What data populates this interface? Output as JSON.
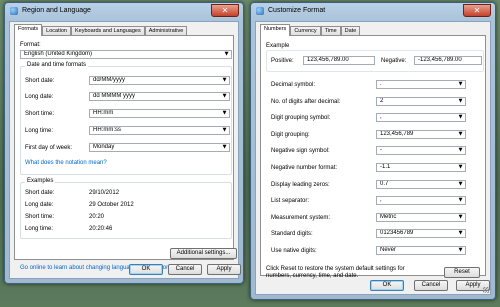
{
  "left_window": {
    "title": "Region and Language",
    "tabs": [
      "Formats",
      "Location",
      "Keyboards and Languages",
      "Administrative"
    ],
    "format_label": "Format:",
    "format_value": "English (United Kingdom)",
    "datetime_group": "Date and time formats",
    "short_date_label": "Short date:",
    "short_date_value": "dd/MM/yyyy",
    "long_date_label": "Long date:",
    "long_date_value": "dd MMMM yyyy",
    "short_time_label": "Short time:",
    "short_time_value": "HH:mm",
    "long_time_label": "Long time:",
    "long_time_value": "HH:mm:ss",
    "first_day_label": "First day of week:",
    "first_day_value": "Monday",
    "notation_link": "What does the notation mean?",
    "examples_group": "Examples",
    "ex_short_date_label": "Short date:",
    "ex_short_date_value": "29/10/2012",
    "ex_long_date_label": "Long date:",
    "ex_long_date_value": "29 October 2012",
    "ex_short_time_label": "Short time:",
    "ex_short_time_value": "20:20",
    "ex_long_time_label": "Long time:",
    "ex_long_time_value": "20:20:46",
    "additional_button": "Additional settings...",
    "online_link": "Go online to learn about changing languages and regional formats",
    "ok": "OK",
    "cancel": "Cancel",
    "apply": "Apply"
  },
  "right_window": {
    "title": "Customize Format",
    "tabs": [
      "Numbers",
      "Currency",
      "Time",
      "Date"
    ],
    "example_label": "Example",
    "positive_label": "Positive:",
    "positive_value": "123,456,789.00",
    "negative_label": "Negative:",
    "negative_value": "-123,456,789.00",
    "rows": [
      {
        "label": "Decimal symbol:",
        "value": "."
      },
      {
        "label": "No. of digits after decimal:",
        "value": "2"
      },
      {
        "label": "Digit grouping symbol:",
        "value": ","
      },
      {
        "label": "Digit grouping:",
        "value": "123,456,789"
      },
      {
        "label": "Negative sign symbol:",
        "value": "-"
      },
      {
        "label": "Negative number format:",
        "value": "-1.1"
      },
      {
        "label": "Display leading zeros:",
        "value": "0.7"
      },
      {
        "label": "List separator:",
        "value": ","
      },
      {
        "label": "Measurement system:",
        "value": "Metric"
      },
      {
        "label": "Standard digits:",
        "value": "0123456789"
      },
      {
        "label": "Use native digits:",
        "value": "Never"
      }
    ],
    "reset_text_1": "Click Reset to restore the system default settings for",
    "reset_text_2": "numbers, currency, time, and date.",
    "reset_button": "Reset",
    "ok": "OK",
    "cancel": "Cancel",
    "apply": "Apply"
  },
  "colors": {
    "link": "#0066cc",
    "title_bar": "#a9c3da",
    "close_button": "#c3432b"
  }
}
